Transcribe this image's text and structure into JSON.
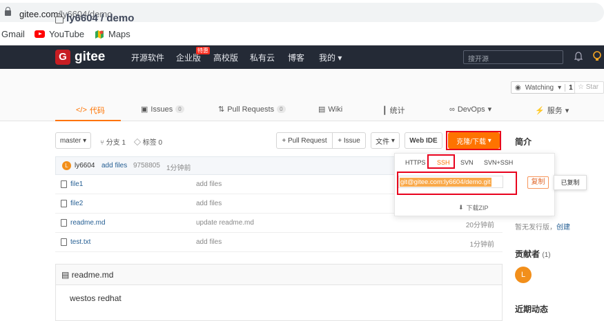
{
  "browser": {
    "url_host": "gitee.com",
    "url_path": "/ly6604/demo",
    "bookmarks": [
      "Gmail",
      "YouTube",
      "Maps"
    ]
  },
  "nav": {
    "logo": "gitee",
    "logo_mark": "G",
    "items": [
      "开源软件",
      "企业版",
      "高校版",
      "私有云",
      "博客",
      "我的"
    ],
    "hot_badge": "特惠",
    "search_placeholder": "搜开源"
  },
  "repo": {
    "owner_repo": "ly6604 / demo",
    "watch_label": "Watching",
    "watch_count": "1",
    "star_label": "Star",
    "tabs": [
      {
        "label": "代码",
        "count": ""
      },
      {
        "label": "Issues",
        "count": "0"
      },
      {
        "label": "Pull Requests",
        "count": "0"
      },
      {
        "label": "Wiki",
        "count": ""
      },
      {
        "label": "统计",
        "count": ""
      },
      {
        "label": "DevOps",
        "count": ""
      },
      {
        "label": "服务",
        "count": ""
      }
    ]
  },
  "toolbar": {
    "branch": "master",
    "branches": "分支 1",
    "tags": "标签 0",
    "pull_request": "+ Pull Request",
    "issue": "+ Issue",
    "file": "文件",
    "web_ide": "Web IDE",
    "clone": "克隆/下载"
  },
  "commit": {
    "avatar": "L",
    "author": "ly6604",
    "message": "add files",
    "hash": "9758805",
    "time": "1分钟前"
  },
  "files": [
    {
      "name": "file1",
      "message": "add files",
      "time": ""
    },
    {
      "name": "file2",
      "message": "add files",
      "time": ""
    },
    {
      "name": "readme.md",
      "message": "update readme.md",
      "time": "20分钟前"
    },
    {
      "name": "test.txt",
      "message": "add files",
      "time": "1分钟前"
    }
  ],
  "readme": {
    "title": "readme.md",
    "body": "westos redhat"
  },
  "sidebar": {
    "intro": "简介",
    "no_release": "暂无发行版，",
    "create": "创建",
    "contributors": "贡献者",
    "contributors_count": "(1)",
    "contributor_avatar": "L",
    "recent": "近期动态"
  },
  "clone_dropdown": {
    "protocols": [
      "HTTPS",
      "SSH",
      "SVN",
      "SVN+SSH"
    ],
    "url": "git@gitee.com:ly6604/demo.git",
    "copy": "复制",
    "copied": "已复制",
    "download_zip": "下载ZIP"
  },
  "colors": {
    "nav_bg": "#242a36",
    "accent": "#fe7300",
    "highlight": "#e8001c"
  }
}
